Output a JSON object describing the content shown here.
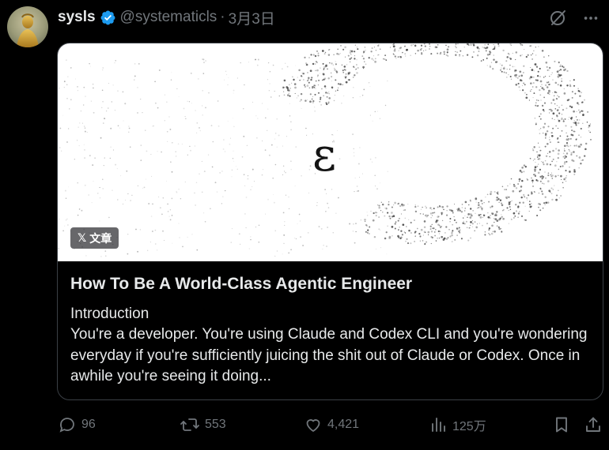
{
  "post": {
    "display_name": "sysls",
    "handle": "@systematicls",
    "separator": "·",
    "date": "3月3日",
    "verified": true
  },
  "card": {
    "image_glyph": "ɛ",
    "badge_logo": "𝕏",
    "badge_label": "文章",
    "title": "How To Be A World-Class Agentic Engineer",
    "subtitle": "Introduction",
    "excerpt": "You're a developer. You're using Claude and Codex CLI and you're wondering everyday if you're sufficiently juicing the shit out of Claude or Codex. Once in awhile you're seeing it doing..."
  },
  "actions": {
    "replies": "96",
    "reposts": "553",
    "likes": "4,421",
    "views": "125万"
  },
  "icons": {
    "verified": "verified-badge-icon",
    "grok": "grok-icon",
    "more": "more-icon",
    "reply": "reply-icon",
    "repost": "repost-icon",
    "like": "heart-icon",
    "views": "views-icon",
    "bookmark": "bookmark-icon",
    "share": "share-icon"
  },
  "colors": {
    "background": "#000000",
    "text_primary": "#e7e9ea",
    "text_secondary": "#71767b",
    "verified": "#1d9bf0",
    "card_border": "#3b4046"
  }
}
